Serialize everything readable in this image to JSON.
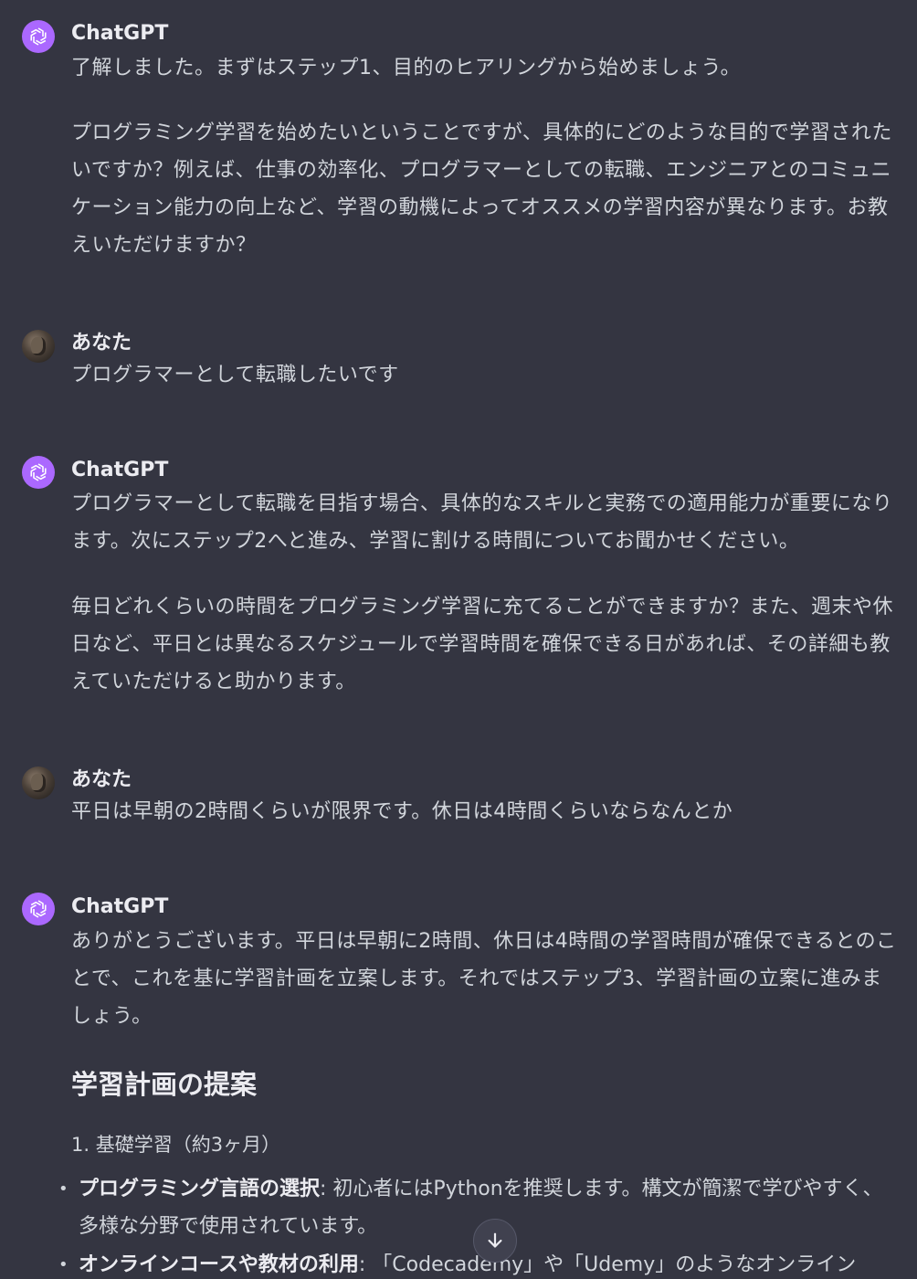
{
  "messages": [
    {
      "author": "ChatGPT",
      "paragraphs": [
        "了解しました。まずはステップ1、目的のヒアリングから始めましょう。",
        "プログラミング学習を始めたいということですが、具体的にどのような目的で学習されたいですか？例えば、仕事の効率化、プログラマーとしての転職、エンジニアとのコミュニケーション能力の向上など、学習の動機によってオススメの学習内容が異なります。お教えいただけますか？"
      ]
    },
    {
      "author": "あなた",
      "paragraphs": [
        "プログラマーとして転職したいです"
      ]
    },
    {
      "author": "ChatGPT",
      "paragraphs": [
        "プログラマーとして転職を目指す場合、具体的なスキルと実務での適用能力が重要になります。次にステップ2へと進み、学習に割ける時間についてお聞かせください。",
        "毎日どれくらいの時間をプログラミング学習に充てることができますか？また、週末や休日など、平日とは異なるスケジュールで学習時間を確保できる日があれば、その詳細も教えていただけると助かります。"
      ]
    },
    {
      "author": "あなた",
      "paragraphs": [
        "平日は早朝の2時間くらいが限界です。休日は4時間くらいならなんとか"
      ]
    },
    {
      "author": "ChatGPT",
      "paragraphs": [
        "ありがとうございます。平日は早朝に2時間、休日は4時間の学習時間が確保できるとのことで、これを基に学習計画を立案します。それではステップ3、学習計画の立案に進みましょう。"
      ],
      "heading": "学習計画の提案",
      "list_item": "1. 基礎学習（約3ヶ月）",
      "bullets": [
        {
          "bold": "プログラミング言語の選択",
          "text": ": 初心者にはPythonを推奨します。構文が簡潔で学びやすく、多様な分野で使用されています。"
        },
        {
          "bold": "オンラインコースや教材の利用",
          "text": ": 「Codecademy」や「Udemy」のようなオンライン"
        }
      ]
    }
  ],
  "icons": {
    "assistant_avatar": "openai-logo-icon",
    "user_avatar": "user-photo-avatar",
    "scroll_down": "arrow-down-icon"
  },
  "colors": {
    "background": "#343541",
    "assistant_avatar_bg": "#ab68ff",
    "text": "#d1d5db"
  }
}
